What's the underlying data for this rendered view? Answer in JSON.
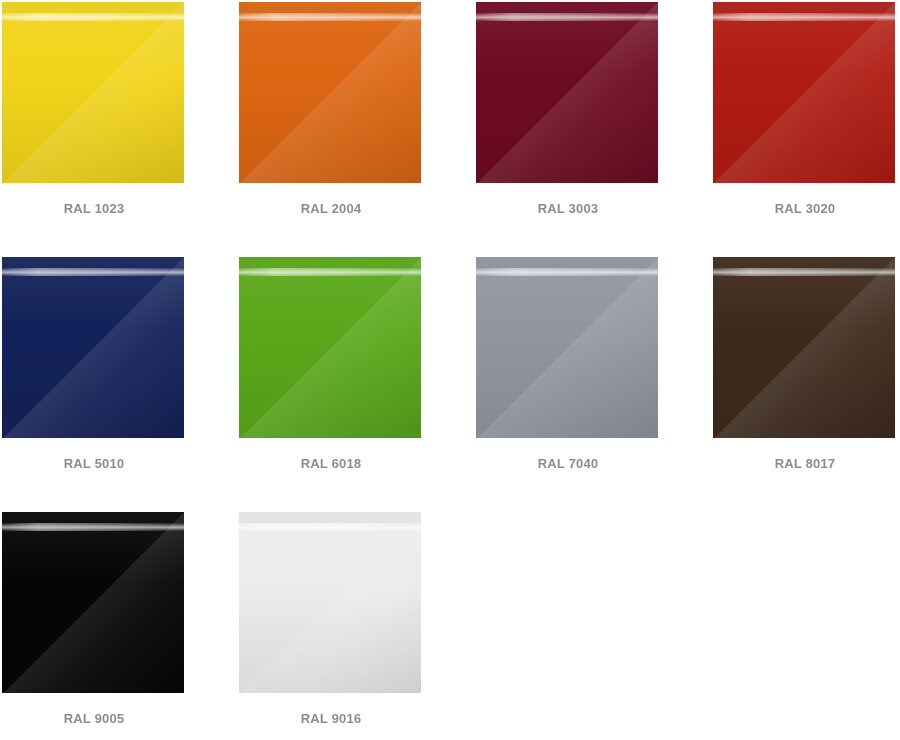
{
  "swatches": [
    {
      "label": "RAL 1023",
      "color": "#f2d41a"
    },
    {
      "label": "RAL 2004",
      "color": "#dd6612"
    },
    {
      "label": "RAL 3003",
      "color": "#6e0b22"
    },
    {
      "label": "RAL 3020",
      "color": "#b01c12"
    },
    {
      "label": "RAL 5010",
      "color": "#13225a"
    },
    {
      "label": "RAL 6018",
      "color": "#5aa81a"
    },
    {
      "label": "RAL 7040",
      "color": "#9196a0"
    },
    {
      "label": "RAL 8017",
      "color": "#3e2a1c"
    },
    {
      "label": "RAL 9005",
      "color": "#050505"
    },
    {
      "label": "RAL 9016",
      "color": "#ececec"
    }
  ]
}
